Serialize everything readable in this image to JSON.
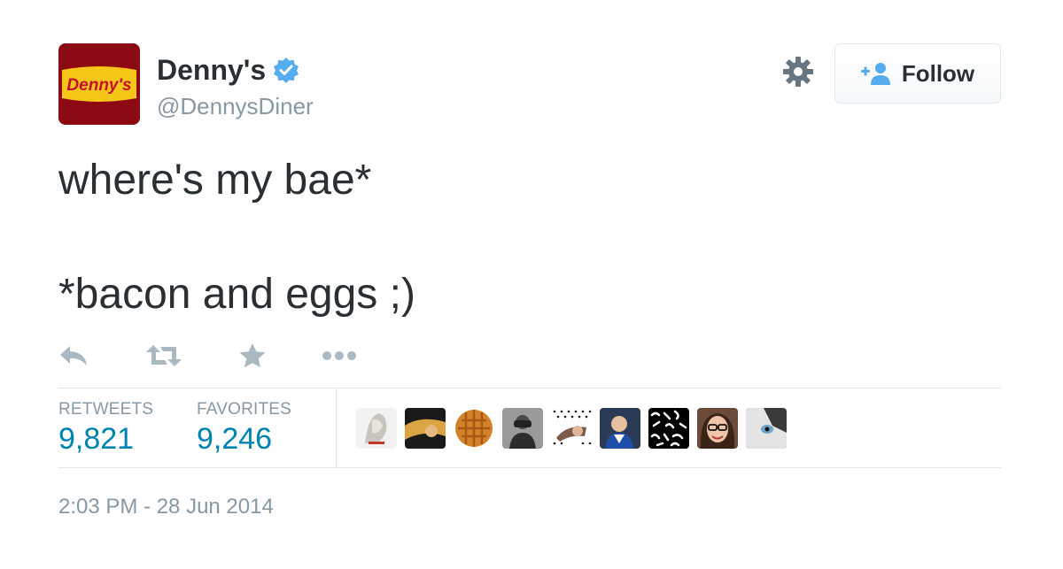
{
  "account": {
    "display_name": "Denny's",
    "handle": "@DennysDiner",
    "avatar_logo_text": "Denny's"
  },
  "follow_button": {
    "label": "Follow"
  },
  "tweet": {
    "line1": "where's my bae*",
    "line2": "*bacon and eggs ;)"
  },
  "stats": {
    "retweets_label": "RETWEETS",
    "retweets_value": "9,821",
    "favorites_label": "FAVORITES",
    "favorites_value": "9,246"
  },
  "timestamp": "2:03 PM - 28 Jun 2014",
  "icons": {
    "verified": "verified-badge-icon",
    "settings": "gear-icon",
    "follow": "add-user-icon",
    "reply": "reply-icon",
    "retweet": "retweet-icon",
    "favorite": "star-icon",
    "more": "more-icon"
  },
  "colors": {
    "link_blue": "#0084b4",
    "muted_gray": "#8899a6",
    "text_dark": "#292f33",
    "verified_blue": "#55acee",
    "brand_red": "#8b0a14",
    "brand_yellow": "#f5c518"
  },
  "favoriters": [
    "favoriter-avatar-1",
    "favoriter-avatar-2",
    "favoriter-avatar-3",
    "favoriter-avatar-4",
    "favoriter-avatar-5",
    "favoriter-avatar-6",
    "favoriter-avatar-7",
    "favoriter-avatar-8",
    "favoriter-avatar-9"
  ]
}
